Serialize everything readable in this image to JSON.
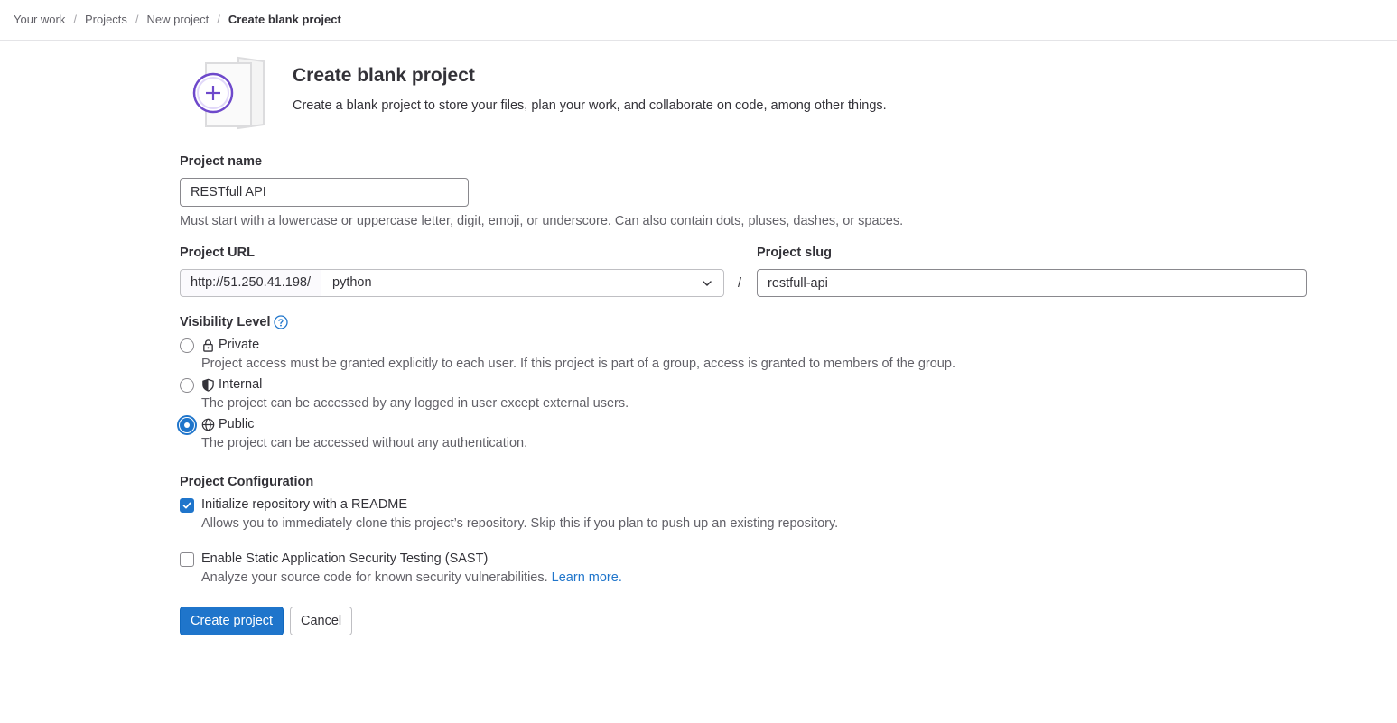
{
  "breadcrumb": {
    "items": [
      "Your work",
      "Projects",
      "New project"
    ],
    "current": "Create blank project"
  },
  "hero": {
    "title": "Create blank project",
    "description": "Create a blank project to store your files, plan your work, and collaborate on code, among other things.",
    "accent_color": "#6e49cb"
  },
  "project_name": {
    "label": "Project name",
    "value": "RESTfull API",
    "help": "Must start with a lowercase or uppercase letter, digit, emoji, or underscore. Can also contain dots, pluses, dashes, or spaces."
  },
  "project_url": {
    "label": "Project URL",
    "prefix": "http://51.250.41.198/",
    "namespace": "python",
    "separator": "/"
  },
  "project_slug": {
    "label": "Project slug",
    "value": "restfull-api"
  },
  "visibility": {
    "label": "Visibility Level",
    "selected": "public",
    "options": [
      {
        "id": "private",
        "icon": "lock-icon",
        "title": "Private",
        "description": "Project access must be granted explicitly to each user. If this project is part of a group, access is granted to members of the group."
      },
      {
        "id": "internal",
        "icon": "shield-icon",
        "title": "Internal",
        "description": "The project can be accessed by any logged in user except external users."
      },
      {
        "id": "public",
        "icon": "globe-icon",
        "title": "Public",
        "description": "The project can be accessed without any authentication."
      }
    ]
  },
  "configuration": {
    "label": "Project Configuration",
    "readme": {
      "label": "Initialize repository with a README",
      "help": "Allows you to immediately clone this project’s repository. Skip this if you plan to push up an existing repository.",
      "checked": true
    },
    "sast": {
      "label": "Enable Static Application Security Testing (SAST)",
      "help": "Analyze your source code for known security vulnerabilities.",
      "learn_more": "Learn more.",
      "checked": false
    }
  },
  "actions": {
    "create": "Create project",
    "cancel": "Cancel",
    "primary_color": "#1f75cb"
  }
}
